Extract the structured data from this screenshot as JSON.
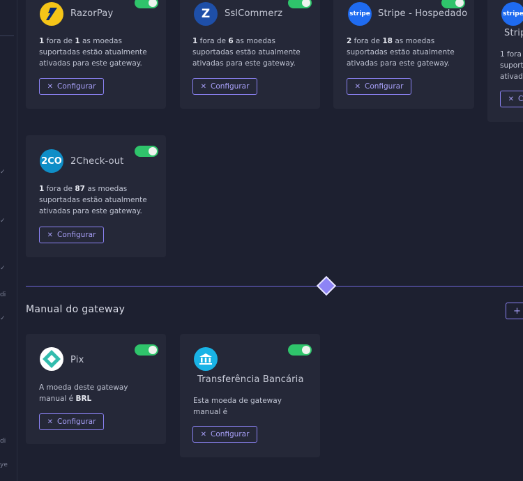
{
  "gateways": [
    {
      "name": "RazorPay",
      "active": "1",
      "total": "1",
      "logo": "razorpay-icon"
    },
    {
      "name": "SslCommerz",
      "active": "1",
      "total": "6",
      "logo": "sslcommerz-icon"
    },
    {
      "name": "Stripe - Hospedado",
      "active": "2",
      "total": "18",
      "logo": "stripe-icon",
      "logo_text": "stripe"
    },
    {
      "name": "Strip",
      "active": "1",
      "total": "",
      "logo": "stripe-icon",
      "logo_text": "stripe"
    },
    {
      "name": "2Check-out",
      "active": "1",
      "total": "87",
      "logo": "2checkout-icon",
      "logo_text": "2CO"
    }
  ],
  "text": {
    "fora_de": "fora de",
    "as_moedas": "as moedas",
    "supported_tail": "suportadas estão atualmente ativadas para este gateway.",
    "partial_card4": [
      "1 fora",
      "suport",
      "ativad"
    ]
  },
  "buttons": {
    "configure": "Configurar",
    "add": "+"
  },
  "manual_section": {
    "title": "Manual do gateway"
  },
  "manual_gateways": [
    {
      "name": "Pix",
      "desc_prefix": "A moeda deste gateway manual é",
      "currency": "BRL"
    },
    {
      "name": "Transferência Bancária",
      "desc_prefix": "Esta moeda de gateway manual é",
      "currency": ""
    }
  ],
  "colors": {
    "accent": "#8b82f3",
    "toggle_on": "#2fc46b",
    "card_bg": "#252838",
    "page_bg": "#1d2030"
  },
  "sidebar_marks": [
    "✓",
    "✓",
    "✓",
    "di",
    "✓",
    "di",
    "ye"
  ]
}
